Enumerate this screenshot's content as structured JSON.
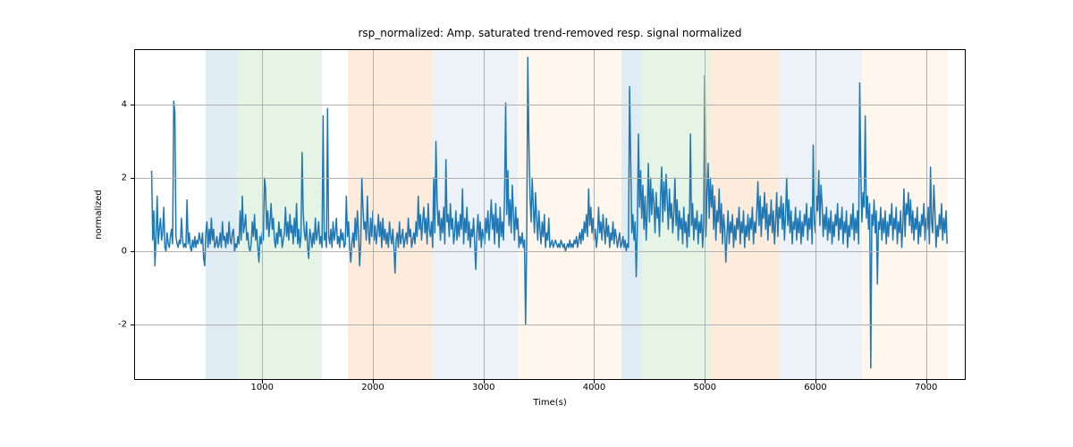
{
  "chart_data": {
    "type": "line",
    "title": "rsp_normalized: Amp. saturated trend-removed resp. signal normalized",
    "xlabel": "Time(s)",
    "ylabel": "normalized",
    "xlim": [
      -150,
      7350
    ],
    "ylim": [
      -3.5,
      5.5
    ],
    "xticks": [
      1000,
      2000,
      3000,
      4000,
      5000,
      6000,
      7000
    ],
    "yticks": [
      -2,
      0,
      2,
      4
    ],
    "grid": true,
    "shaded_regions": [
      {
        "x0": 490,
        "x1": 770,
        "color": "#6ea8c9"
      },
      {
        "x0": 770,
        "x1": 1540,
        "color": "#8ecf8e"
      },
      {
        "x0": 1770,
        "x1": 2530,
        "color": "#f4a460"
      },
      {
        "x0": 2530,
        "x1": 3310,
        "color": "#a9c4de"
      },
      {
        "x0": 3310,
        "x1": 4250,
        "color": "#ffd9b3"
      },
      {
        "x0": 4250,
        "x1": 4430,
        "color": "#6ea8c9"
      },
      {
        "x0": 4430,
        "x1": 5050,
        "color": "#8ecf8e"
      },
      {
        "x0": 5050,
        "x1": 5680,
        "color": "#f4a460"
      },
      {
        "x0": 5680,
        "x1": 6420,
        "color": "#a9c4de"
      },
      {
        "x0": 6420,
        "x1": 7200,
        "color": "#ffd9b3"
      }
    ],
    "series": [
      {
        "name": "rsp_normalized",
        "color": "#1f77b4",
        "x_start": 0,
        "x_step": 10,
        "y": [
          2.2,
          0.3,
          1.1,
          -0.4,
          0.4,
          1.5,
          0.2,
          0.6,
          0.9,
          0.3,
          0.5,
          1.2,
          0.1,
          0.0,
          0.5,
          0.2,
          0.1,
          0.4,
          0.6,
          0.2,
          4.1,
          3.8,
          0.4,
          0.2,
          0.1,
          0.3,
          0.2,
          0.9,
          0.3,
          0.1,
          0.2,
          0.1,
          1.4,
          0.2,
          0.5,
          0.1,
          0.0,
          0.3,
          0.1,
          0.4,
          0.1,
          0.3,
          0.2,
          0.5,
          0.3,
          0.2,
          0.5,
          -0.2,
          -0.4,
          0.5,
          0.8,
          0.1,
          0.6,
          0.2,
          0.9,
          0.3,
          0.6,
          0.1,
          0.2,
          0.4,
          0.1,
          0.2,
          0.5,
          0.1,
          0.8,
          0.3,
          0.4,
          0.1,
          0.5,
          0.2,
          0.8,
          0.3,
          0.2,
          0.5,
          0.6,
          0.0,
          0.2,
          0.1,
          0.4,
          0.2,
          1.1,
          0.3,
          1.5,
          0.5,
          0.7,
          1.0,
          0.3,
          0.5,
          0.1,
          0.0,
          0.2,
          0.8,
          0.4,
          1.0,
          0.3,
          0.6,
          0.1,
          -0.3,
          0.4,
          0.2,
          0.5,
          0.3,
          2.0,
          1.7,
          0.6,
          1.1,
          0.4,
          0.8,
          1.3,
          0.6,
          0.9,
          0.3,
          0.1,
          0.5,
          0.2,
          0.8,
          0.4,
          0.6,
          0.1,
          0.3,
          0.5,
          1.2,
          0.4,
          0.8,
          0.3,
          1.0,
          0.5,
          0.7,
          0.2,
          0.9,
          0.4,
          1.3,
          0.2,
          0.6,
          0.1,
          0.4,
          2.7,
          1.1,
          0.5,
          0.3,
          0.8,
          0.1,
          -0.2,
          0.6,
          0.4,
          0.1,
          0.5,
          0.2,
          0.9,
          0.3,
          0.5,
          0.8,
          0.2,
          0.4,
          0.1,
          3.7,
          0.3,
          0.5,
          0.1,
          3.9,
          0.4,
          0.2,
          0.6,
          0.1,
          0.8,
          0.3,
          0.5,
          0.9,
          0.2,
          0.4,
          0.1,
          0.6,
          0.3,
          0.5,
          0.1,
          0.2,
          1.5,
          0.4,
          0.8,
          0.1,
          -0.3,
          0.2,
          0.5,
          0.1,
          0.9,
          0.3,
          1.1,
          0.5,
          -0.4,
          0.2,
          2.0,
          1.2,
          0.6,
          0.8,
          0.3,
          1.5,
          0.5,
          0.2,
          0.9,
          0.4,
          1.1,
          0.3,
          0.7,
          0.2,
          0.5,
          1.0,
          0.4,
          0.8,
          0.1,
          0.9,
          0.3,
          0.6,
          0.2,
          0.5,
          0.1,
          0.8,
          0.4,
          0.2,
          0.6,
          0.1,
          -0.6,
          0.3,
          0.5,
          0.1,
          0.8,
          0.2,
          0.4,
          0.6,
          0.1,
          0.3,
          0.5,
          0.2,
          0.9,
          0.4,
          0.6,
          0.1,
          0.3,
          0.5,
          0.2,
          0.8,
          0.4,
          1.5,
          0.6,
          1.0,
          0.3,
          0.8,
          1.2,
          0.5,
          0.9,
          0.2,
          1.3,
          0.6,
          0.4,
          0.8,
          0.1,
          2.0,
          0.5,
          3.0,
          1.4,
          0.7,
          1.1,
          0.3,
          0.9,
          0.5,
          1.2,
          0.2,
          2.5,
          0.8,
          1.0,
          0.4,
          1.3,
          0.6,
          0.9,
          0.2,
          0.5,
          1.1,
          0.3,
          0.8,
          0.4,
          1.0,
          0.6,
          1.7,
          0.2,
          0.9,
          0.5,
          1.2,
          0.3,
          0.8,
          0.1,
          0.6,
          0.4,
          0.9,
          0.2,
          -0.5,
          0.5,
          1.0,
          0.3,
          0.8,
          0.1,
          0.6,
          0.4,
          0.2,
          0.9,
          0.5,
          1.1,
          0.3,
          0.8,
          1.4,
          0.6,
          1.0,
          0.2,
          1.3,
          0.5,
          0.9,
          0.1,
          1.2,
          0.4,
          0.8,
          0.3,
          1.5,
          4.05,
          1.0,
          2.2,
          0.7,
          1.4,
          0.5,
          1.8,
          1.0,
          0.3,
          1.2,
          0.6,
          0.9,
          0.1,
          0.4,
          0.2,
          0.5,
          0.1,
          0.3,
          -2.0,
          0.2,
          5.3,
          3.0,
          1.5,
          0.8,
          2.0,
          1.2,
          0.5,
          1.6,
          0.9,
          0.3,
          1.1,
          0.6,
          0.2,
          0.8,
          0.4,
          1.0,
          0.1,
          0.5,
          0.3,
          0.9,
          0.1,
          0.2,
          0.3,
          0.1,
          0.2,
          0.3,
          0.2,
          0.1,
          0.2,
          0.1,
          0.3,
          0.2,
          0.1,
          0.2,
          0.0,
          0.1,
          0.2,
          0.1,
          0.3,
          0.1,
          0.2,
          0.1,
          0.3,
          0.2,
          0.4,
          0.1,
          0.3,
          0.5,
          0.2,
          0.6,
          0.3,
          0.8,
          0.5,
          1.0,
          0.4,
          1.7,
          0.7,
          1.2,
          0.5,
          0.9,
          0.3,
          0.6,
          0.1,
          0.4,
          1.2,
          0.5,
          0.8,
          0.3,
          1.0,
          0.6,
          0.2,
          0.9,
          0.4,
          0.7,
          0.1,
          0.5,
          0.3,
          0.8,
          0.2,
          0.6,
          0.4,
          0.1,
          0.3,
          0.5,
          0.1,
          0.2,
          0.4,
          0.1,
          0.3,
          0.0,
          0.2,
          0.1,
          4.5,
          2.5,
          0.5,
          1.0,
          0.3,
          0.8,
          -0.7,
          0.6,
          3.2,
          1.2,
          2.2,
          0.9,
          1.8,
          0.6,
          1.5,
          0.3,
          1.1,
          2.4,
          0.8,
          2.0,
          1.0,
          1.7,
          1.3,
          0.5,
          1.6,
          0.9,
          1.2,
          0.4,
          1.5,
          2.3,
          0.8,
          1.9,
          1.1,
          2.1,
          1.4,
          0.6,
          1.7,
          0.9,
          1.3,
          0.5,
          1.0,
          2.0,
          0.7,
          1.4,
          0.3,
          1.1,
          0.6,
          0.9,
          0.2,
          1.2,
          0.5,
          0.8,
          0.1,
          1.0,
          0.4,
          3.2,
          0.7,
          1.3,
          0.3,
          0.9,
          0.6,
          1.1,
          0.2,
          0.8,
          0.5,
          1.0,
          0.1,
          0.7,
          4.8,
          0.4,
          1.6,
          2.4,
          0.9,
          2.0,
          1.2,
          1.8,
          0.6,
          1.5,
          0.3,
          1.1,
          0.8,
          1.7,
          0.5,
          1.3,
          0.2,
          1.0,
          0.6,
          -0.3,
          0.4,
          1.1,
          0.2,
          0.8,
          0.5,
          1.0,
          0.1,
          0.7,
          0.3,
          0.9,
          0.6,
          1.2,
          0.2,
          0.8,
          0.5,
          1.1,
          0.1,
          0.7,
          0.4,
          1.0,
          0.3,
          0.9,
          0.6,
          1.2,
          0.2,
          0.8,
          0.5,
          1.1,
          1.9,
          0.7,
          1.5,
          0.4,
          1.2,
          0.9,
          1.6,
          0.6,
          1.3,
          0.3,
          1.0,
          0.7,
          1.4,
          0.5,
          1.1,
          0.2,
          0.8,
          1.6,
          0.4,
          1.2,
          0.9,
          1.5,
          0.6,
          1.3,
          0.3,
          1.0,
          2.0,
          0.7,
          1.4,
          0.5,
          1.1,
          0.2,
          0.8,
          0.6,
          1.2,
          0.3,
          0.9,
          0.5,
          1.1,
          0.2,
          0.8,
          0.4,
          1.0,
          0.7,
          1.3,
          0.3,
          0.9,
          0.6,
          1.2,
          0.2,
          2.9,
          0.8,
          0.5,
          1.5,
          1.1,
          2.2,
          0.7,
          1.8,
          1.3,
          0.4,
          1.0,
          0.6,
          1.2,
          0.3,
          0.9,
          0.5,
          1.1,
          0.2,
          0.8,
          0.4,
          1.0,
          0.7,
          1.3,
          0.3,
          0.9,
          0.6,
          1.2,
          0.2,
          0.8,
          0.5,
          1.1,
          0.1,
          0.7,
          0.4,
          1.0,
          0.6,
          1.3,
          0.3,
          0.9,
          0.5,
          1.1,
          0.2,
          4.6,
          2.2,
          0.8,
          1.6,
          1.2,
          3.7,
          0.9,
          1.5,
          0.6,
          1.3,
          -3.2,
          1.0,
          0.7,
          1.4,
          0.5,
          1.1,
          -0.9,
          0.8,
          0.6,
          1.2,
          0.3,
          0.9,
          0.5,
          1.1,
          0.2,
          0.8,
          0.4,
          1.0,
          0.7,
          1.3,
          0.3,
          0.9,
          0.6,
          1.2,
          0.2,
          0.8,
          0.5,
          1.1,
          0.1,
          0.7,
          1.7,
          0.4,
          1.3,
          1.0,
          1.6,
          0.7,
          1.4,
          0.5,
          1.1,
          0.3,
          0.9,
          0.6,
          1.2,
          0.2,
          0.8,
          0.4,
          1.0,
          0.7,
          1.3,
          0.3,
          0.9,
          0.6,
          1.2,
          0.2,
          2.3,
          0.8,
          0.5,
          1.8,
          1.1,
          0.1,
          0.7,
          0.4,
          1.0,
          0.6,
          1.3,
          0.3,
          0.9,
          0.5,
          1.1,
          0.2
        ]
      }
    ]
  }
}
